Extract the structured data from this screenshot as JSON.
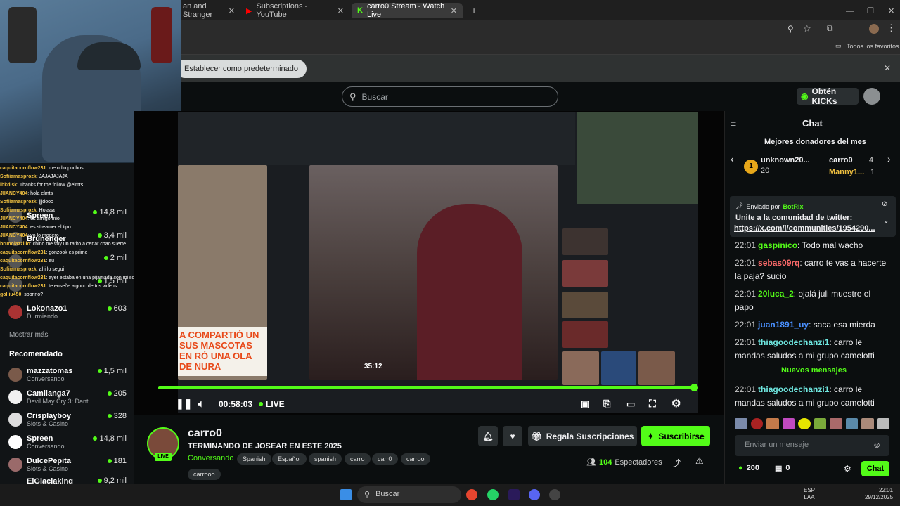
{
  "browser": {
    "tabs": [
      {
        "label": "an and Stranger"
      },
      {
        "label": "Subscriptions - YouTube"
      },
      {
        "label": "carro0 Stream - Watch Live"
      }
    ],
    "bookmarks_label": "Todos los favoritos",
    "default_prompt": "Establecer como predeterminado"
  },
  "header": {
    "search_placeholder": "Buscar",
    "kicks_button": "Obtén KICKs"
  },
  "overlay_chat": [
    {
      "user": "caquitacornflow231",
      "text": ": me odio puchos"
    },
    {
      "user": "Sofiiamasprozk",
      "text": ": JAJAJAJAJA"
    },
    {
      "user": "ibkdlsk",
      "text": ": Thanks for the follow @elmts"
    },
    {
      "user": "JIIANCY404",
      "text": ": hola elmts"
    },
    {
      "user": "Sofiiamasprozk",
      "text": ": jjjdooo"
    },
    {
      "user": "Sofiiamasprozk",
      "text": ": Holaaa"
    },
    {
      "user": "JIIANCY404",
      "text": ": es amigo mio"
    },
    {
      "user": "JIIANCY404",
      "text": ": es streamer el tipo"
    },
    {
      "user": "JIIANCY404",
      "text": ": yo lo modero"
    },
    {
      "user": "brunolazzillo",
      "text": ": chino me voy un ratito a cenar chao suerte"
    },
    {
      "user": "caquitacornflow231",
      "text": ": gonzook es prime"
    },
    {
      "user": "caquitacornflow231",
      "text": ": eu"
    },
    {
      "user": "Sofiiamasprozk",
      "text": ": ahi lo segui"
    },
    {
      "user": "caquitacornflow231",
      "text": ": ayer estaba en una pijamada con mi sobrino, y le habie d oos"
    },
    {
      "user": "caquitacornflow231",
      "text": ": te enseñe alguno de tus videos"
    },
    {
      "user": "goliiu450",
      "text": ": sobrino?"
    }
  ],
  "sidebar": {
    "following": [
      {
        "name": "Spreen",
        "count": "14,8 mil"
      },
      {
        "name": "Brunenger",
        "count": "3,4 mil"
      },
      {
        "name": "",
        "count": "2 mil"
      },
      {
        "name": "",
        "count": "1,5 mil"
      },
      {
        "name": "Lokonazo1",
        "category": "Durmiendo",
        "count": "603"
      }
    ],
    "show_more": "Mostrar más",
    "recommended_title": "Recomendado",
    "recommended": [
      {
        "name": "mazzatomas",
        "category": "Conversando",
        "count": "1,5 mil"
      },
      {
        "name": "Camilanga7",
        "category": "Devil May Cry 3: Dant...",
        "count": "205"
      },
      {
        "name": "Crisplayboy",
        "category": "Slots & Casino",
        "count": "328"
      },
      {
        "name": "Spreen",
        "category": "Conversando",
        "count": "14,8 mil"
      },
      {
        "name": "DulcePepita",
        "category": "Slots & Casino",
        "count": "181"
      },
      {
        "name": "ElGlaciaking",
        "category": "",
        "count": "9,2 mil"
      }
    ]
  },
  "player": {
    "elapsed": "00:58:03",
    "live_label": "LIVE",
    "progress": 1.0,
    "inner_time": "35:12",
    "inner_banner": "A COMPARTIÓ UN SUS MASCOTAS EN RÓ UNA OLA DE NURA"
  },
  "stream": {
    "channel": "carro0",
    "title": "TERMINANDO DE JOSEAR EN ESTE 2025",
    "category": "Conversando",
    "tags": [
      "Spanish",
      "Español",
      "spanish",
      "carro",
      "carr0",
      "carroo",
      "carrooo"
    ],
    "live_badge": "LIVE",
    "gift_button": "Regala Suscripciones",
    "subscribe_button": "Suscribirse",
    "viewers": "104",
    "viewers_label": "Espectadores"
  },
  "chat": {
    "title": "Chat",
    "top_donors_title": "Mejores donadores del mes",
    "donors": [
      {
        "name": "unknown20...",
        "value": "20"
      },
      {
        "name": "carro0",
        "value": "4"
      },
      {
        "name": "Manny1...",
        "value": "1"
      }
    ],
    "pinned": {
      "sent_by": "Enviado por",
      "bot": "BotRix",
      "text": "Unite a la comunidad de twitter:",
      "link": "https://x.com/i/communities/1954290..."
    },
    "messages": [
      {
        "time": "22:01",
        "user": "gaspinico",
        "color": "#53fc18",
        "text": "Todo mal wacho"
      },
      {
        "time": "22:01",
        "user": "sebas09rq",
        "color": "#ff6b6b",
        "text": "carro te vas a hacerte la paja? sucio"
      },
      {
        "time": "22:01",
        "user": "20luca_2",
        "color": "#53fc18",
        "text": "ojalá juli muestre el papo"
      },
      {
        "time": "22:01",
        "user": "juan1891_uy",
        "color": "#4a90ff",
        "text": "saca esa mierda"
      },
      {
        "time": "22:01",
        "user": "thiagoodechanzi1",
        "color": "#6fe7e0",
        "text": "carro le mandas saludos a mi grupo camelotti"
      }
    ],
    "new_messages_label": "Nuevos mensajes",
    "after_new": [
      {
        "time": "22:01",
        "user": "thiagoodechanzi1",
        "color": "#6fe7e0",
        "text": "carro le mandas saludos a mi grupo camelotti"
      }
    ],
    "input_placeholder": "Enviar un mensaje",
    "points": "200",
    "gifts": "0",
    "send_button": "Chat"
  },
  "taskbar": {
    "search": "Buscar",
    "lang": "ESP",
    "lang2": "LAA",
    "time": "22:01",
    "date": "29/12/2025"
  }
}
